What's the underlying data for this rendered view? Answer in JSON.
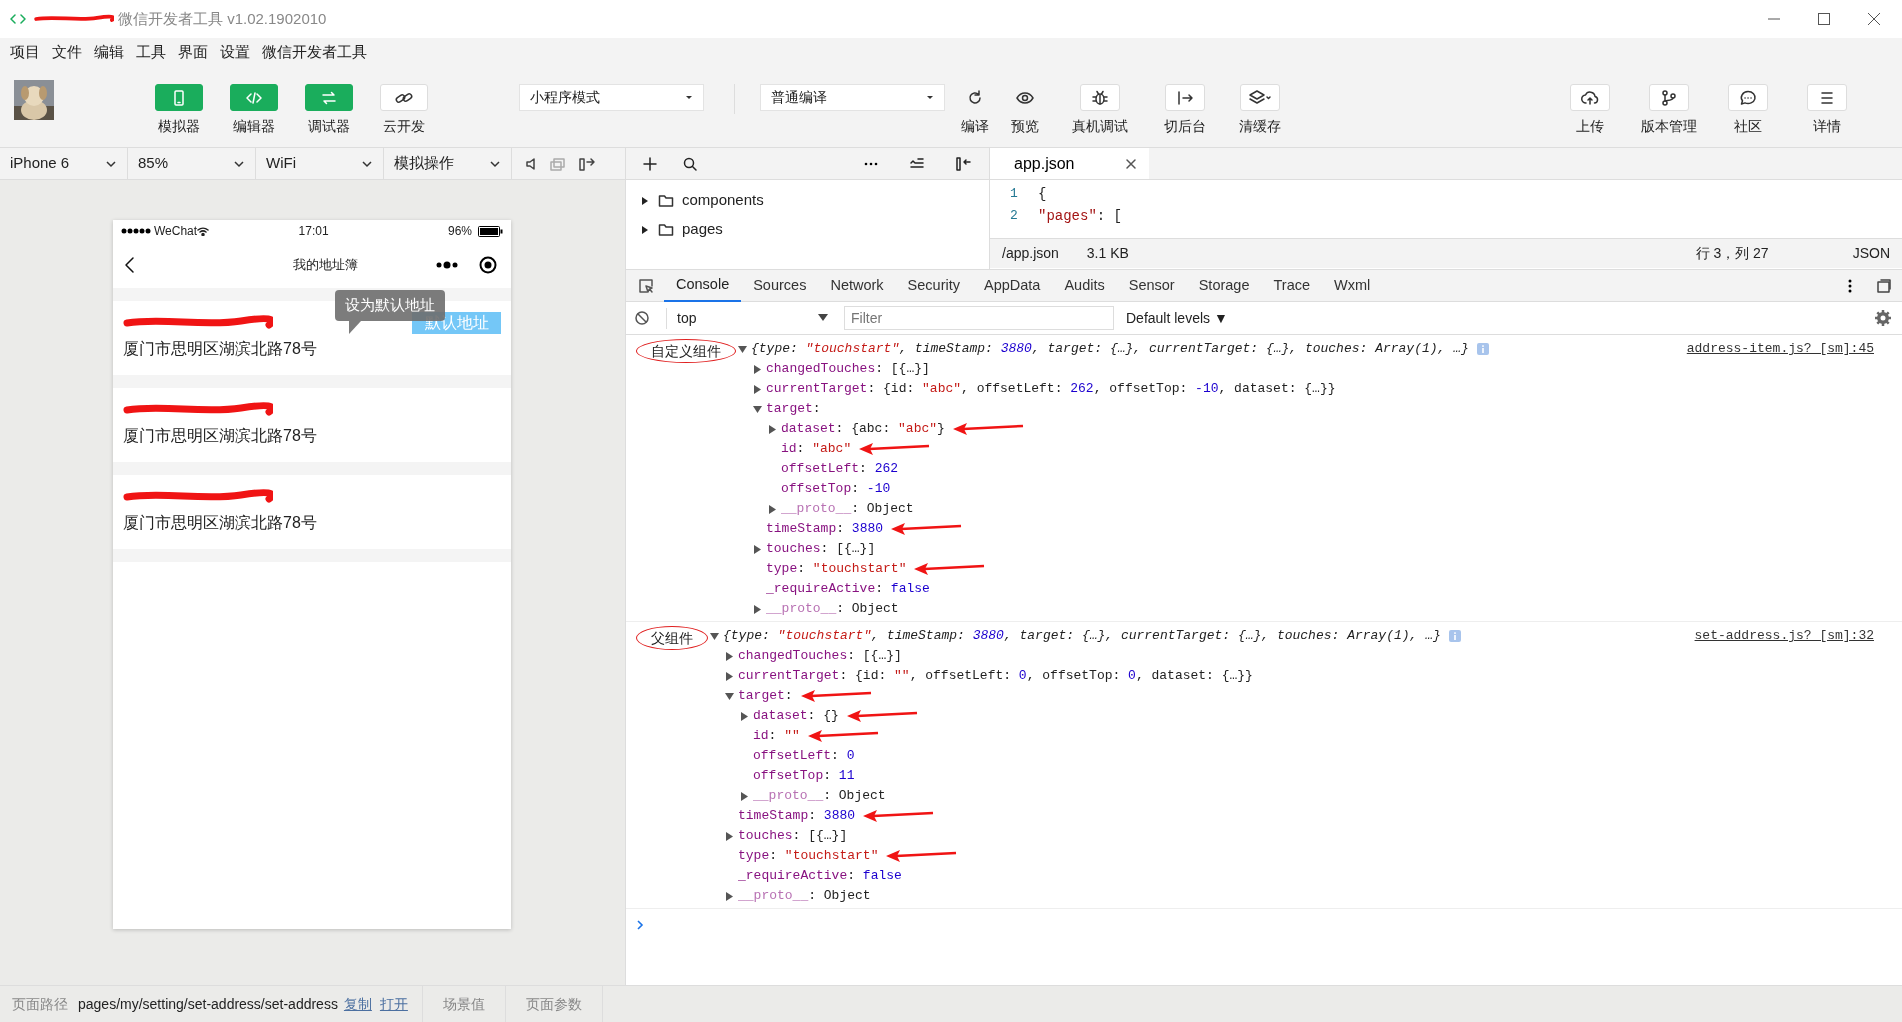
{
  "window": {
    "title": "微信开发者工具 v1.02.1902010",
    "redacted": true
  },
  "menu": [
    "项目",
    "文件",
    "编辑",
    "工具",
    "界面",
    "设置",
    "微信开发者工具"
  ],
  "toolbar": {
    "toggles": [
      {
        "label": "模拟器",
        "on": true
      },
      {
        "label": "编辑器",
        "on": true
      },
      {
        "label": "调试器",
        "on": true
      },
      {
        "label": "云开发",
        "on": false
      }
    ],
    "mode_select": "小程序模式",
    "compile_select": "普通编译",
    "actions": [
      "编译",
      "预览",
      "真机调试",
      "切后台",
      "清缓存"
    ],
    "right_actions": [
      "上传",
      "版本管理",
      "社区",
      "详情"
    ]
  },
  "device_bar": {
    "selects": [
      "iPhone 6",
      "85%",
      "WiFi",
      "模拟操作"
    ]
  },
  "phone": {
    "carrier": "WeChat",
    "time": "17:01",
    "battery": "96%",
    "nav_title": "我的地址簿",
    "addresses": [
      {
        "redacted": true,
        "address": "厦门市思明区湖滨北路78号",
        "badge": "默认地址",
        "tooltip": "设为默认地址"
      },
      {
        "redacted": true,
        "address": "厦门市思明区湖滨北路78号"
      },
      {
        "redacted": true,
        "address": "厦门市思明区湖滨北路78号"
      }
    ]
  },
  "file_tree": {
    "items": [
      {
        "label": "components",
        "expanded": false
      },
      {
        "label": "pages",
        "expanded": false
      }
    ]
  },
  "editor": {
    "tab": "app.json",
    "code": [
      {
        "num": "1",
        "tokens": [
          {
            "kind": "plain",
            "text": "{"
          }
        ]
      },
      {
        "num": "2",
        "tokens": [
          {
            "kind": "string",
            "text": "\"pages\""
          },
          {
            "kind": "plain",
            "text": ": ["
          }
        ]
      }
    ],
    "status": {
      "path": "/app.json",
      "size": "3.1 KB",
      "cursor": "行 3，列 27",
      "language": "JSON"
    }
  },
  "devtools": {
    "tabs": [
      {
        "label": "Console",
        "selected": true
      },
      {
        "label": "Sources",
        "selected": false
      },
      {
        "label": "Network",
        "selected": false
      },
      {
        "label": "Security",
        "selected": false
      },
      {
        "label": "AppData",
        "selected": false
      },
      {
        "label": "Audits",
        "selected": false
      },
      {
        "label": "Sensor",
        "selected": false
      },
      {
        "label": "Storage",
        "selected": false
      },
      {
        "label": "Trace",
        "selected": false
      },
      {
        "label": "Wxml",
        "selected": false
      }
    ],
    "context": "top",
    "filter_placeholder": "Filter",
    "levels": "Default levels ▼"
  },
  "console": {
    "groups": [
      {
        "label": "自定义组件",
        "circled": true,
        "source": "address-item.js? [sm]:45",
        "expanded": true,
        "summary": [
          {
            "kind": "plain",
            "text": "{type: "
          },
          {
            "kind": "string",
            "text": "\"touchstart\""
          },
          {
            "kind": "plain",
            "text": ", timeStamp: "
          },
          {
            "kind": "number",
            "text": "3880"
          },
          {
            "kind": "plain",
            "text": ", target: {…}, currentTarget: {…}, touches: Array(1), …}"
          }
        ],
        "lines": [
          {
            "key": "changedTouches",
            "value": [
              {
                "kind": "plain",
                "text": ": [{…}]"
              }
            ],
            "expanded": false
          },
          {
            "key": "currentTarget",
            "value": [
              {
                "kind": "plain",
                "text": ": {id: "
              },
              {
                "kind": "string",
                "text": "\"abc\""
              },
              {
                "kind": "plain",
                "text": ", offsetLeft: "
              },
              {
                "kind": "number",
                "text": "262"
              },
              {
                "kind": "plain",
                "text": ", offsetTop: "
              },
              {
                "kind": "number",
                "text": "-10"
              },
              {
                "kind": "plain",
                "text": ", dataset: {…}}"
              }
            ],
            "expanded": false
          },
          {
            "key": "target",
            "value": [
              {
                "kind": "plain",
                "text": ":"
              }
            ],
            "expanded": true,
            "children": [
              {
                "key": "dataset",
                "value": [
                  {
                    "kind": "plain",
                    "text": ": {abc: "
                  },
                  {
                    "kind": "string",
                    "text": "\"abc\""
                  },
                  {
                    "kind": "plain",
                    "text": "}"
                  }
                ],
                "expanded": false,
                "arrow": true
              },
              {
                "key": "id",
                "value": [
                  {
                    "kind": "plain",
                    "text": ": "
                  },
                  {
                    "kind": "string",
                    "text": "\"abc\""
                  }
                ],
                "arrow": true
              },
              {
                "key": "offsetLeft",
                "value": [
                  {
                    "kind": "plain",
                    "text": ": "
                  },
                  {
                    "kind": "number",
                    "text": "262"
                  }
                ]
              },
              {
                "key": "offsetTop",
                "value": [
                  {
                    "kind": "plain",
                    "text": ": "
                  },
                  {
                    "kind": "number",
                    "text": "-10"
                  }
                ]
              },
              {
                "key": "__proto__",
                "dim": true,
                "value": [
                  {
                    "kind": "plain",
                    "text": ": Object"
                  }
                ],
                "expanded": false
              }
            ]
          },
          {
            "key": "timeStamp",
            "value": [
              {
                "kind": "plain",
                "text": ": "
              },
              {
                "kind": "number",
                "text": "3880"
              }
            ],
            "arrow": true
          },
          {
            "key": "touches",
            "value": [
              {
                "kind": "plain",
                "text": ": [{…}]"
              }
            ],
            "expanded": false
          },
          {
            "key": "type",
            "value": [
              {
                "kind": "plain",
                "text": ": "
              },
              {
                "kind": "string",
                "text": "\"touchstart\""
              }
            ],
            "arrow": true
          },
          {
            "key": "_requireActive",
            "value": [
              {
                "kind": "plain",
                "text": ": "
              },
              {
                "kind": "number",
                "text": "false"
              }
            ]
          },
          {
            "key": "__proto__",
            "dim": true,
            "value": [
              {
                "kind": "plain",
                "text": ": Object"
              }
            ],
            "expanded": false
          }
        ]
      },
      {
        "label": "父组件",
        "circled": true,
        "source": "set-address.js? [sm]:32",
        "expanded": true,
        "summary": [
          {
            "kind": "plain",
            "text": "{type: "
          },
          {
            "kind": "string",
            "text": "\"touchstart\""
          },
          {
            "kind": "plain",
            "text": ", timeStamp: "
          },
          {
            "kind": "number",
            "text": "3880"
          },
          {
            "kind": "plain",
            "text": ", target: {…}, currentTarget: {…}, touches: Array(1), …}"
          }
        ],
        "lines": [
          {
            "key": "changedTouches",
            "value": [
              {
                "kind": "plain",
                "text": ": [{…}]"
              }
            ],
            "expanded": false
          },
          {
            "key": "currentTarget",
            "value": [
              {
                "kind": "plain",
                "text": ": {id: "
              },
              {
                "kind": "string",
                "text": "\"\""
              },
              {
                "kind": "plain",
                "text": ", offsetLeft: "
              },
              {
                "kind": "number",
                "text": "0"
              },
              {
                "kind": "plain",
                "text": ", offsetTop: "
              },
              {
                "kind": "number",
                "text": "0"
              },
              {
                "kind": "plain",
                "text": ", dataset: {…}}"
              }
            ],
            "expanded": false
          },
          {
            "key": "target",
            "value": [
              {
                "kind": "plain",
                "text": ":"
              }
            ],
            "expanded": true,
            "arrow": true,
            "children": [
              {
                "key": "dataset",
                "value": [
                  {
                    "kind": "plain",
                    "text": ": {}"
                  }
                ],
                "expanded": false,
                "arrow": true
              },
              {
                "key": "id",
                "value": [
                  {
                    "kind": "plain",
                    "text": ": "
                  },
                  {
                    "kind": "string",
                    "text": "\"\""
                  }
                ],
                "arrow": true
              },
              {
                "key": "offsetLeft",
                "value": [
                  {
                    "kind": "plain",
                    "text": ": "
                  },
                  {
                    "kind": "number",
                    "text": "0"
                  }
                ]
              },
              {
                "key": "offsetTop",
                "value": [
                  {
                    "kind": "plain",
                    "text": ": "
                  },
                  {
                    "kind": "number",
                    "text": "11"
                  }
                ]
              },
              {
                "key": "__proto__",
                "dim": true,
                "value": [
                  {
                    "kind": "plain",
                    "text": ": Object"
                  }
                ],
                "expanded": false
              }
            ]
          },
          {
            "key": "timeStamp",
            "value": [
              {
                "kind": "plain",
                "text": ": "
              },
              {
                "kind": "number",
                "text": "3880"
              }
            ],
            "arrow": true
          },
          {
            "key": "touches",
            "value": [
              {
                "kind": "plain",
                "text": ": [{…}]"
              }
            ],
            "expanded": false
          },
          {
            "key": "type",
            "value": [
              {
                "kind": "plain",
                "text": ": "
              },
              {
                "kind": "string",
                "text": "\"touchstart\""
              }
            ],
            "arrow": true
          },
          {
            "key": "_requireActive",
            "value": [
              {
                "kind": "plain",
                "text": ": "
              },
              {
                "kind": "number",
                "text": "false"
              }
            ]
          },
          {
            "key": "__proto__",
            "dim": true,
            "value": [
              {
                "kind": "plain",
                "text": ": Object"
              }
            ],
            "expanded": false
          }
        ]
      }
    ]
  },
  "bottom_bar": {
    "path_label": "页面路径",
    "path": "pages/my/setting/set-address/set-address",
    "links": [
      "复制",
      "打开"
    ],
    "tabs": [
      "场景值",
      "页面参数"
    ]
  }
}
